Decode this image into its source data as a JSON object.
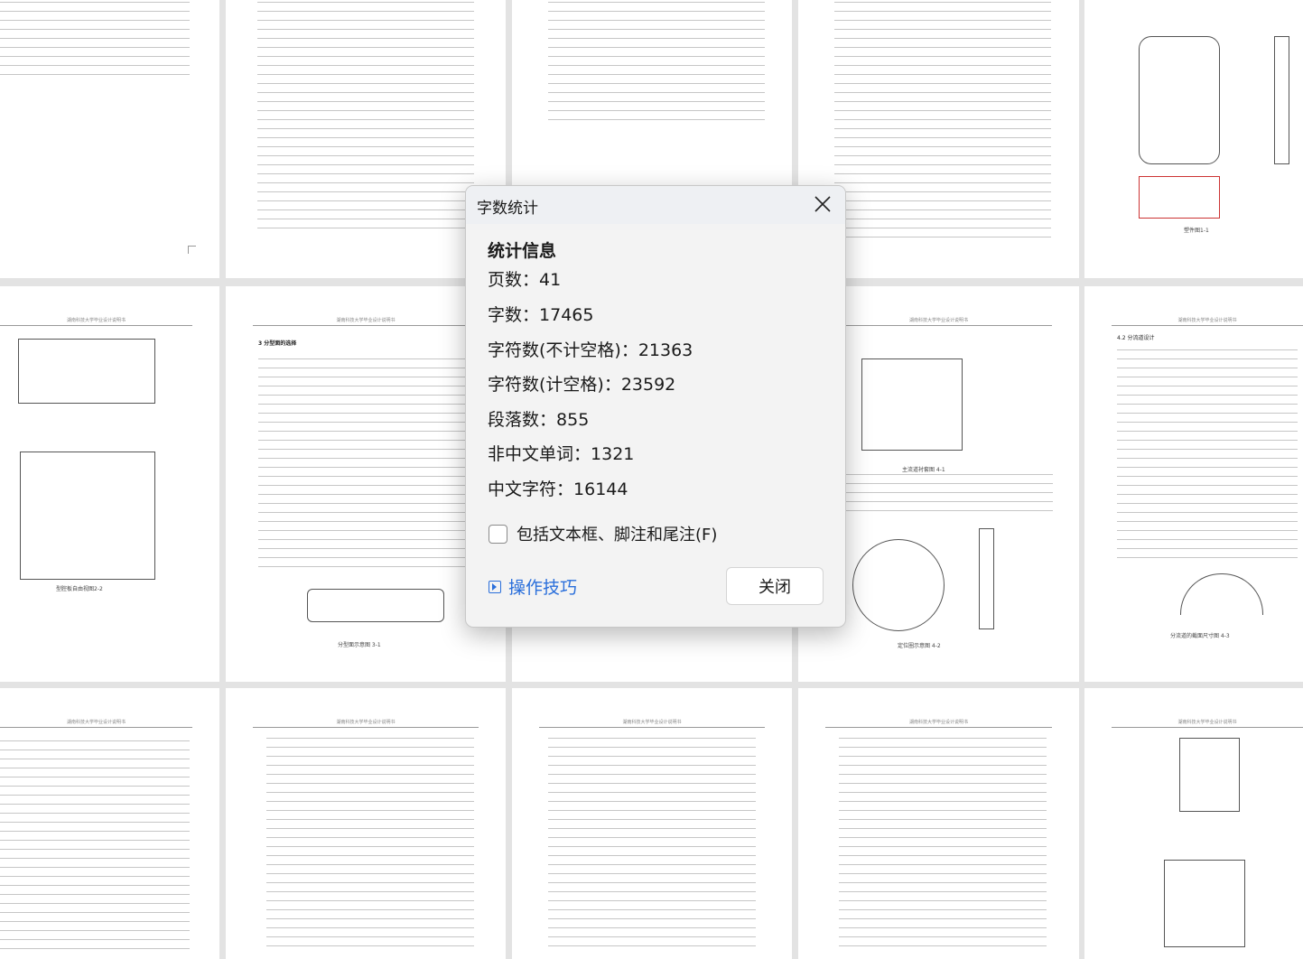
{
  "document": {
    "page_header": "湖南科技大学毕业设计说明书",
    "headings": [
      "3 分型面的选择",
      "4.2 分流道设计"
    ],
    "captions": [
      "型腔板自由视图2-2",
      "分型面示意图 3-1",
      "定位圈示意图 4-2",
      "分流道的截面尺寸图 4-3",
      "主流道衬套图 4-1",
      "塑件图1-1"
    ]
  },
  "dialog": {
    "title": "字数统计",
    "section_title": "统计信息",
    "stats": [
      {
        "label": "页数：",
        "value": "41"
      },
      {
        "label": "字数：",
        "value": "17465"
      },
      {
        "label": "字符数(不计空格)：",
        "value": "21363"
      },
      {
        "label": "字符数(计空格)：",
        "value": "23592"
      },
      {
        "label": "段落数：",
        "value": "855"
      },
      {
        "label": "非中文单词：",
        "value": "1321"
      },
      {
        "label": "中文字符：",
        "value": "16144"
      }
    ],
    "checkbox_label": "包括文本框、脚注和尾注(F)",
    "checkbox_checked": false,
    "tips_link": "操作技巧",
    "close_button": "关闭",
    "accent_color": "#2a6fdb"
  }
}
